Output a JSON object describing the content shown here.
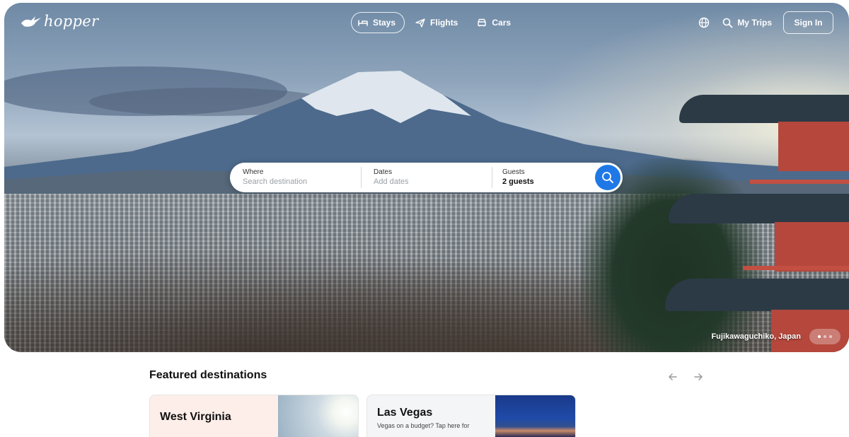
{
  "nav": {
    "brand": "hopper",
    "tabs": [
      {
        "label": "Stays",
        "icon": "bed-icon",
        "active": true
      },
      {
        "label": "Flights",
        "icon": "plane-icon",
        "active": false
      },
      {
        "label": "Cars",
        "icon": "car-icon",
        "active": false
      }
    ],
    "my_trips": "My Trips",
    "sign_in": "Sign In"
  },
  "search": {
    "where_label": "Where",
    "where_placeholder": "Search destination",
    "dates_label": "Dates",
    "dates_placeholder": "Add dates",
    "guests_label": "Guests",
    "guests_value": "2 guests"
  },
  "hero": {
    "caption": "Fujikawaguchiko, Japan",
    "slides": 3,
    "active_slide": 1
  },
  "featured": {
    "title": "Featured destinations",
    "cards": [
      {
        "title": "West Virginia",
        "subtitle": "",
        "bg": "#fdeee9"
      },
      {
        "title": "Las Vegas",
        "subtitle": "Vegas on a budget? Tap here for",
        "bg": "#f4f5f7"
      }
    ]
  },
  "colors": {
    "accent": "#1f78e6",
    "text": "#111111"
  }
}
